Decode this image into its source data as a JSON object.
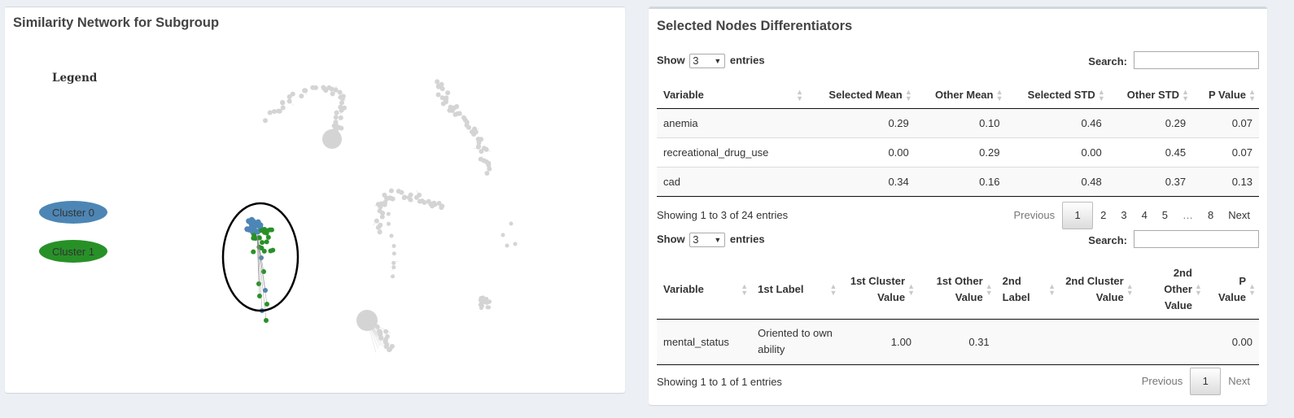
{
  "left_panel": {
    "title": "Similarity Network for Subgroup",
    "legend": {
      "title": "Legend",
      "items": [
        {
          "label": "Cluster 0",
          "color": "#4d86b5"
        },
        {
          "label": "Cluster 1",
          "color": "#279127"
        }
      ]
    },
    "colors": {
      "cluster_0": "#4d86b5",
      "cluster_1": "#279127",
      "inactive": "#d4d4d4",
      "selection": "#000000"
    }
  },
  "right_panel": {
    "title": "Selected Nodes Differentiators",
    "table1": {
      "show_label": "Show",
      "entries_label": "entries",
      "page_length": "3",
      "search_label": "Search:",
      "search_value": "",
      "columns": [
        "Variable",
        "Selected Mean",
        "Other Mean",
        "Selected STD",
        "Other STD",
        "P Value"
      ],
      "rows": [
        [
          "anemia",
          "0.29",
          "0.10",
          "0.46",
          "0.29",
          "0.07"
        ],
        [
          "recreational_drug_use",
          "0.00",
          "0.29",
          "0.00",
          "0.45",
          "0.07"
        ],
        [
          "cad",
          "0.34",
          "0.16",
          "0.48",
          "0.37",
          "0.13"
        ]
      ],
      "info": "Showing 1 to 3 of 24 entries",
      "pagination": {
        "previous": "Previous",
        "pages": [
          "1",
          "2",
          "3",
          "4",
          "5",
          "…",
          "8"
        ],
        "current": "1",
        "next": "Next"
      }
    },
    "table2": {
      "show_label": "Show",
      "entries_label": "entries",
      "page_length": "3",
      "search_label": "Search:",
      "search_value": "",
      "columns": [
        "Variable",
        "1st Label",
        "1st Cluster Value",
        "1st Other Value",
        "2nd Label",
        "2nd Cluster Value",
        "2nd Other Value",
        "P Value"
      ],
      "rows": [
        [
          "mental_status",
          "Oriented to own ability",
          "1.00",
          "0.31",
          "",
          "",
          "",
          "0.00"
        ]
      ],
      "info": "Showing 1 to 1 of 1 entries",
      "pagination": {
        "previous": "Previous",
        "pages": [
          "1"
        ],
        "current": "1",
        "next": "Next"
      }
    }
  }
}
